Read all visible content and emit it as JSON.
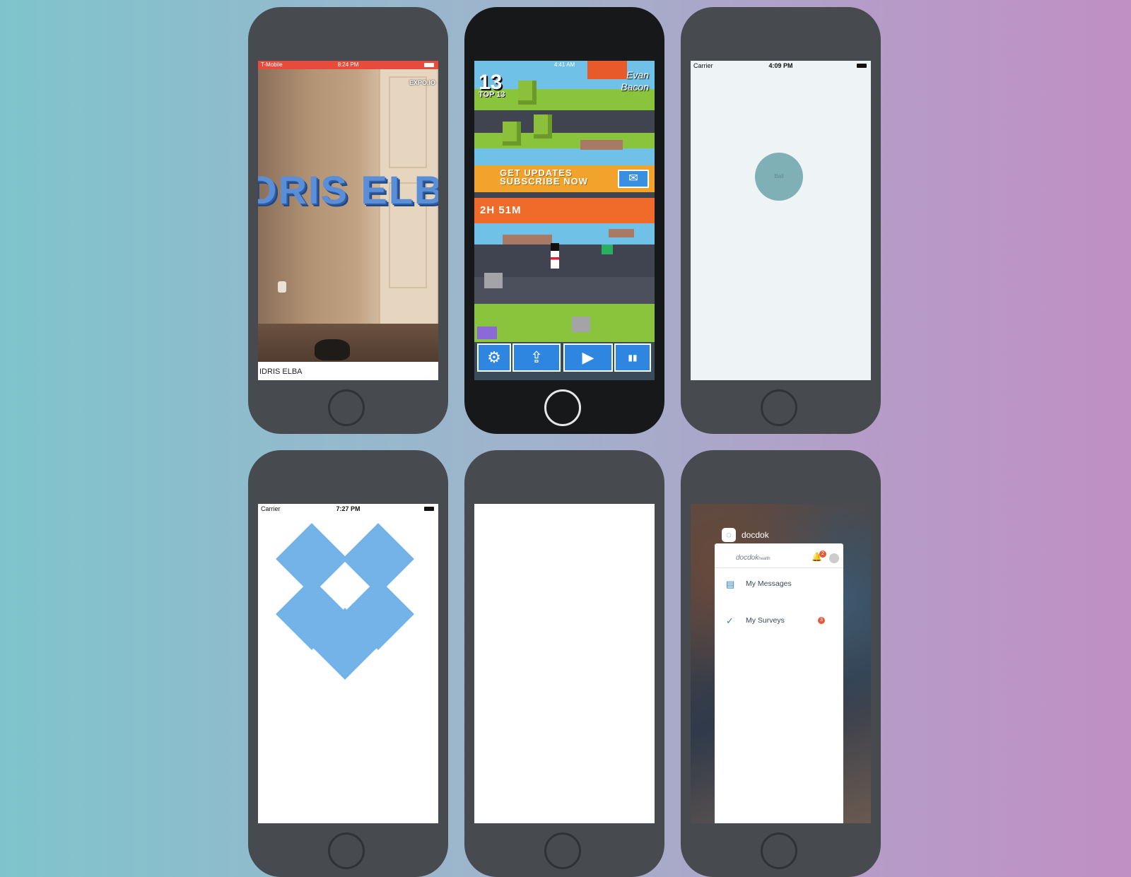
{
  "phone_ar": {
    "status_carrier": "T-Mobile",
    "status_time": "8:24 PM",
    "badge": "EXPO.IO",
    "ar_text": "DRIS ELBA",
    "caption": "IDRIS ELBA"
  },
  "phone_game": {
    "status_time": "4:41 AM",
    "score": "13",
    "top_score": "TOP 13",
    "player_name_line1": "Evan",
    "player_name_line2": "Bacon",
    "subscribe_line1": "GET UPDATES",
    "subscribe_line2": "SUBSCRIBE NOW",
    "timer": "2H 51M",
    "controls": [
      {
        "icon": "gear-icon",
        "glyph": "⚙"
      },
      {
        "icon": "share-icon",
        "glyph": "⇪"
      },
      {
        "icon": "play-icon",
        "glyph": "▶"
      },
      {
        "icon": "leaderboard-icon",
        "glyph": "▮▮"
      }
    ]
  },
  "phone_ball": {
    "status_carrier": "Carrier",
    "status_time": "4:09 PM",
    "ball_label": "Ball"
  },
  "phone_dropbox": {
    "status_carrier": "Carrier",
    "status_time": "7:27 PM"
  },
  "phone_docdok": {
    "app_name": "docdok",
    "brand": "docdok",
    "brand_suffix": "health",
    "notification_count": "2",
    "menu": [
      {
        "label": "My Messages",
        "icon": "chat-icon"
      },
      {
        "label": "My Surveys",
        "icon": "check-icon",
        "badge": "3"
      }
    ]
  },
  "colors": {
    "status_red": "#e74b3c",
    "dropbox_blue": "#74b3e8",
    "ball_teal": "#7fb0b6",
    "game_orange": "#f06b2a",
    "game_button_blue": "#2f86e0"
  }
}
